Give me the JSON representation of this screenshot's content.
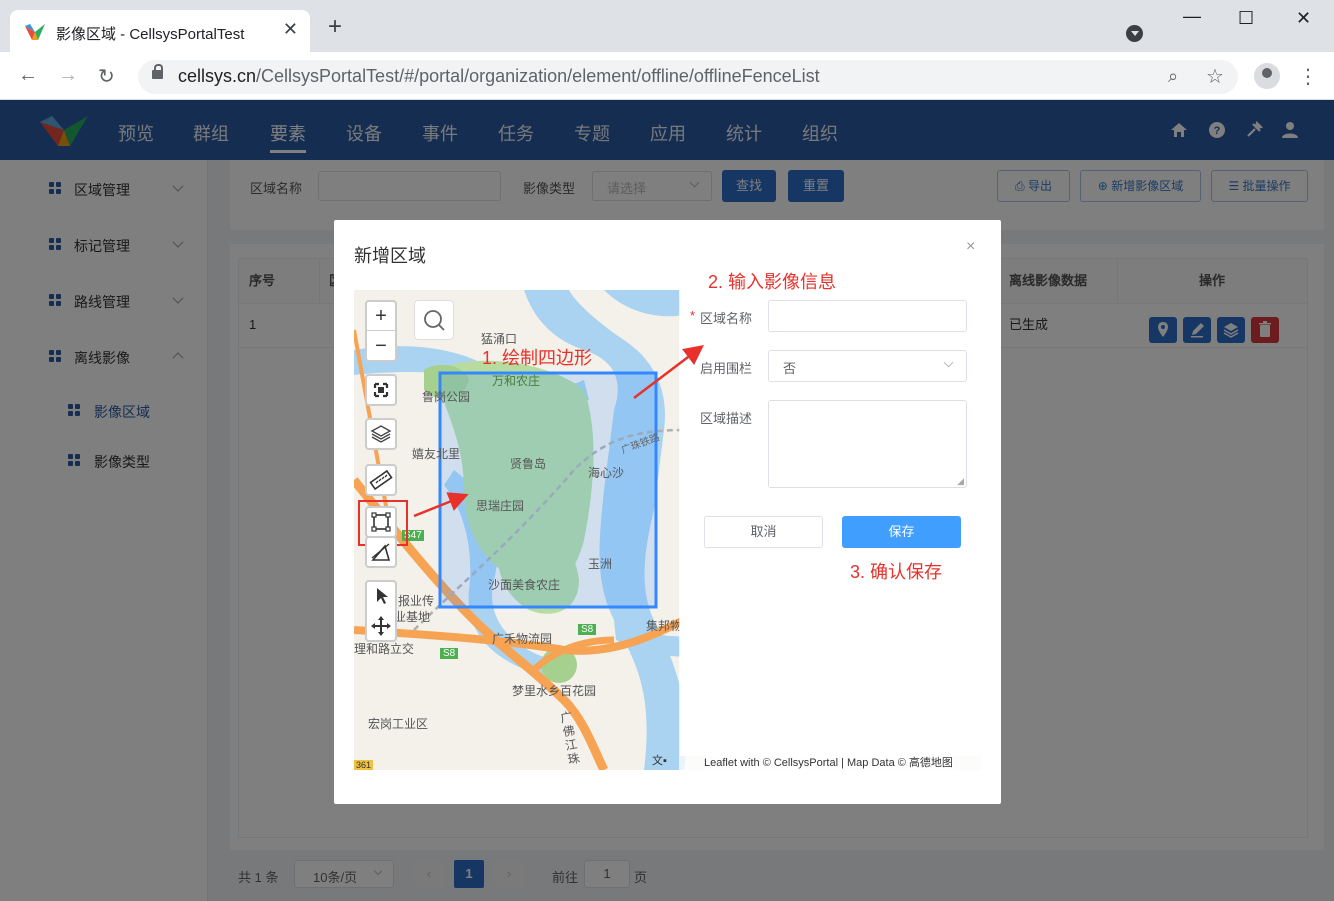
{
  "browser": {
    "tab_title": "影像区域 - CellsysPortalTest",
    "url_host": "cellsys.cn",
    "url_path": "/CellsysPortalTest/#/portal/organization/element/offline/offlineFenceList"
  },
  "nav": {
    "items": [
      "预览",
      "群组",
      "要素",
      "设备",
      "事件",
      "任务",
      "专题",
      "应用",
      "统计",
      "组织"
    ],
    "active": "要素"
  },
  "sidebar": {
    "items": [
      {
        "label": "区域管理"
      },
      {
        "label": "标记管理"
      },
      {
        "label": "路线管理"
      },
      {
        "label": "离线影像"
      }
    ],
    "subitems": [
      {
        "label": "影像区域"
      },
      {
        "label": "影像类型"
      }
    ]
  },
  "filter": {
    "name_label": "区域名称",
    "type_label": "影像类型",
    "type_placeholder": "请选择",
    "search_btn": "查找",
    "reset_btn": "重置",
    "export_btn": "导出",
    "add_btn": "新增影像区域",
    "batch_btn": "批量操作"
  },
  "table": {
    "col_index": "序号",
    "col_partial": "区",
    "col_data": "离线影像数据",
    "col_ops": "操作",
    "row": {
      "index": "1",
      "data_status": "已生成"
    }
  },
  "pager": {
    "total": "共 1 条",
    "page_size": "10条/页",
    "current_page": "1",
    "goto_label": "前往",
    "goto_value": "1",
    "page_suffix": "页"
  },
  "dialog": {
    "title": "新增区域",
    "close": "×",
    "form": {
      "name_label": "区域名称",
      "fence_label": "启用围栏",
      "fence_value": "否",
      "desc_label": "区域描述",
      "cancel_btn": "取消",
      "save_btn": "保存",
      "required_mark": "*"
    },
    "annotations": {
      "step1": "1. 绘制四边形",
      "step2": "2. 输入影像信息",
      "step3": "3. 确认保存"
    },
    "map": {
      "zoom_in": "+",
      "zoom_out": "−",
      "labels": {
        "lugang_park": "鲁岗公园",
        "wanhe_farm": "万和农庄",
        "xilu_north": "嬉友北里",
        "xianludao": "贤鲁岛",
        "siruizhuang": "思瑞庄园",
        "haixinsha": "海心沙",
        "yuzhou": "玉洲",
        "shamian_farm": "沙面美食农庄",
        "baoye_base": "报业传",
        "industry_base": "业基地",
        "lihe_lijiao": "理和路立交",
        "guangmu_logistics": "广禾物流园",
        "jibang": "集邦物",
        "mengli_garden": "梦里水乡百花园",
        "honggang_industry": "宏岗工业区",
        "guangfo_road": "广佛江珠",
        "guangzhu_rail": "广珠铁路",
        "menghuikou": "猛涌口",
        "s8_a": "S8",
        "s8_b": "S8",
        "s47": "S47",
        "s361": "361",
        "attribution": "Leaflet with © CellsysPortal | Map Data © 高德地图",
        "attribution_prefix": "文▪"
      }
    }
  }
}
